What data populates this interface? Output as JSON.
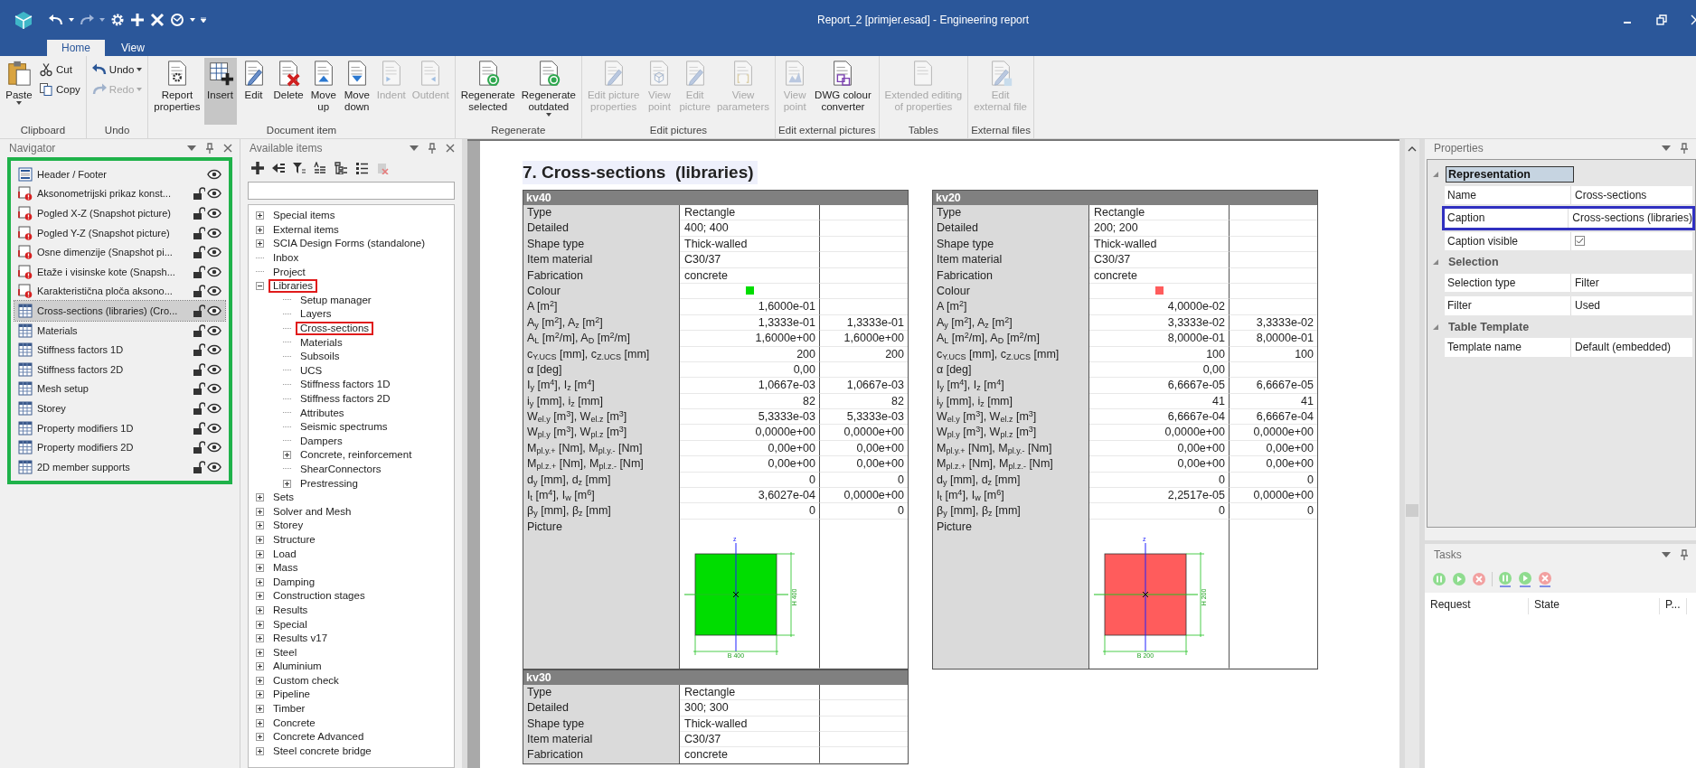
{
  "window": {
    "title": "Report_2 [primjer.esad] - Engineering report"
  },
  "ribbon": {
    "tabs": [
      {
        "label": "Home",
        "selected": true
      },
      {
        "label": "View",
        "selected": false
      }
    ],
    "groups": [
      {
        "label": "Clipboard",
        "buttons": [
          {
            "label": "Paste",
            "kind": "large",
            "dropdown": true,
            "disabled": false,
            "pressed": false
          },
          {
            "label": "Cut",
            "kind": "small",
            "dropdown": false,
            "disabled": false,
            "pressed": false
          },
          {
            "label": "Copy",
            "kind": "small",
            "dropdown": false,
            "disabled": false,
            "pressed": false
          }
        ]
      },
      {
        "label": "Undo",
        "buttons": [
          {
            "label": "Undo",
            "kind": "small",
            "dropdown": true,
            "disabled": false,
            "pressed": false
          },
          {
            "label": "Redo",
            "kind": "small",
            "dropdown": true,
            "disabled": true,
            "pressed": false
          }
        ]
      },
      {
        "label": "Document item",
        "buttons": [
          {
            "label": "Report\nproperties",
            "kind": "large",
            "dropdown": false,
            "disabled": false,
            "pressed": false
          },
          {
            "label": "Insert",
            "kind": "large",
            "dropdown": false,
            "disabled": false,
            "pressed": true
          },
          {
            "label": "Edit",
            "kind": "large",
            "dropdown": false,
            "disabled": false,
            "pressed": false
          },
          {
            "label": "Delete",
            "kind": "large",
            "dropdown": false,
            "disabled": false,
            "pressed": false
          },
          {
            "label": "Move\nup",
            "kind": "large",
            "dropdown": false,
            "disabled": false,
            "pressed": false
          },
          {
            "label": "Move\ndown",
            "kind": "large",
            "dropdown": false,
            "disabled": false,
            "pressed": false
          },
          {
            "label": "Indent",
            "kind": "large",
            "dropdown": false,
            "disabled": true,
            "pressed": false
          },
          {
            "label": "Outdent",
            "kind": "large",
            "dropdown": false,
            "disabled": true,
            "pressed": false
          }
        ]
      },
      {
        "label": "Regenerate",
        "buttons": [
          {
            "label": "Regenerate\nselected",
            "kind": "large",
            "dropdown": false,
            "disabled": false,
            "pressed": false
          },
          {
            "label": "Regenerate\noutdated",
            "kind": "large",
            "dropdown": true,
            "disabled": false,
            "pressed": false
          }
        ]
      },
      {
        "label": "Edit pictures",
        "buttons": [
          {
            "label": "Edit picture\nproperties",
            "kind": "large",
            "dropdown": false,
            "disabled": true,
            "pressed": false
          },
          {
            "label": "View\npoint",
            "kind": "large",
            "dropdown": false,
            "disabled": true,
            "pressed": false
          },
          {
            "label": "Edit\npicture",
            "kind": "large",
            "dropdown": false,
            "disabled": true,
            "pressed": false
          },
          {
            "label": "View\nparameters",
            "kind": "large",
            "dropdown": false,
            "disabled": true,
            "pressed": false
          }
        ]
      },
      {
        "label": "Edit external pictures",
        "buttons": [
          {
            "label": "View\npoint",
            "kind": "large",
            "dropdown": false,
            "disabled": true,
            "pressed": false
          },
          {
            "label": "DWG colour\nconverter",
            "kind": "large",
            "dropdown": false,
            "disabled": false,
            "pressed": false
          }
        ]
      },
      {
        "label": "Tables",
        "buttons": [
          {
            "label": "Extended editing\nof properties",
            "kind": "large",
            "dropdown": false,
            "disabled": true,
            "pressed": false
          }
        ]
      },
      {
        "label": "External files",
        "buttons": [
          {
            "label": "Edit\nexternal file",
            "kind": "large",
            "dropdown": false,
            "disabled": true,
            "pressed": false
          }
        ]
      }
    ]
  },
  "navigator": {
    "title": "Navigator",
    "highlighted": true,
    "items": [
      {
        "label": "Header / Footer",
        "kind": "header",
        "selected": false
      },
      {
        "label": "Aksonometrijski prikaz konst...",
        "kind": "picture",
        "selected": false
      },
      {
        "label": "Pogled X-Z (Snapshot picture)",
        "kind": "picture",
        "selected": false
      },
      {
        "label": "Pogled Y-Z (Snapshot picture)",
        "kind": "picture",
        "selected": false
      },
      {
        "label": "Osne dimenzije (Snapshot pi...",
        "kind": "picture",
        "selected": false
      },
      {
        "label": "Etaže i visinske kote (Snapsh...",
        "kind": "picture",
        "selected": false
      },
      {
        "label": "Karakteristična ploča aksono...",
        "kind": "picture",
        "selected": false
      },
      {
        "label": "Cross-sections (libraries) (Cro...",
        "kind": "table",
        "selected": true
      },
      {
        "label": "Materials",
        "kind": "table",
        "selected": false
      },
      {
        "label": "Stiffness factors 1D",
        "kind": "table",
        "selected": false
      },
      {
        "label": "Stiffness factors 2D",
        "kind": "table",
        "selected": false
      },
      {
        "label": "Mesh setup",
        "kind": "table",
        "selected": false
      },
      {
        "label": "Storey",
        "kind": "table",
        "selected": false
      },
      {
        "label": "Property modifiers 1D",
        "kind": "table",
        "selected": false
      },
      {
        "label": "Property modifiers 2D",
        "kind": "table",
        "selected": false
      },
      {
        "label": "2D member supports",
        "kind": "table",
        "selected": false
      }
    ]
  },
  "available_items": {
    "title": "Available items",
    "tree": [
      {
        "label": "Special items",
        "expanded": false,
        "highlighted": false
      },
      {
        "label": "External items",
        "expanded": false,
        "highlighted": false
      },
      {
        "label": "SCIA Design Forms (standalone)",
        "expanded": false,
        "highlighted": false
      },
      {
        "label": "Inbox",
        "highlighted": false
      },
      {
        "label": "Project",
        "highlighted": false
      },
      {
        "label": "Libraries",
        "expanded": true,
        "highlighted": true,
        "children": [
          {
            "label": "Setup manager",
            "highlighted": false
          },
          {
            "label": "Layers",
            "highlighted": false
          },
          {
            "label": "Cross-sections",
            "highlighted": true
          },
          {
            "label": "Materials",
            "highlighted": false
          },
          {
            "label": "Subsoils",
            "highlighted": false
          },
          {
            "label": "UCS",
            "highlighted": false
          },
          {
            "label": "Stiffness factors 1D",
            "highlighted": false
          },
          {
            "label": "Stiffness factors 2D",
            "highlighted": false
          },
          {
            "label": "Attributes",
            "highlighted": false
          },
          {
            "label": "Seismic spectrums",
            "highlighted": false
          },
          {
            "label": "Dampers",
            "highlighted": false
          },
          {
            "label": "Concrete, reinforcement",
            "expanded": false,
            "highlighted": false
          },
          {
            "label": "ShearConnectors",
            "highlighted": false
          },
          {
            "label": "Prestressing",
            "expanded": false,
            "highlighted": false
          }
        ]
      },
      {
        "label": "Sets",
        "expanded": false,
        "highlighted": false
      },
      {
        "label": "Solver and Mesh",
        "expanded": false,
        "highlighted": false
      },
      {
        "label": "Storey",
        "expanded": false,
        "highlighted": false
      },
      {
        "label": "Structure",
        "expanded": false,
        "highlighted": false
      },
      {
        "label": "Load",
        "expanded": false,
        "highlighted": false
      },
      {
        "label": "Mass",
        "expanded": false,
        "highlighted": false
      },
      {
        "label": "Damping",
        "expanded": false,
        "highlighted": false
      },
      {
        "label": "Construction stages",
        "expanded": false,
        "highlighted": false
      },
      {
        "label": "Results",
        "expanded": false,
        "highlighted": false
      },
      {
        "label": "Special",
        "expanded": false,
        "highlighted": false
      },
      {
        "label": "Results v17",
        "expanded": false,
        "highlighted": false
      },
      {
        "label": "Steel",
        "expanded": false,
        "highlighted": false
      },
      {
        "label": "Aluminium",
        "expanded": false,
        "highlighted": false
      },
      {
        "label": "Custom check",
        "expanded": false,
        "highlighted": false
      },
      {
        "label": "Pipeline",
        "expanded": false,
        "highlighted": false
      },
      {
        "label": "Timber",
        "expanded": false,
        "highlighted": false
      },
      {
        "label": "Concrete",
        "expanded": false,
        "highlighted": false
      },
      {
        "label": "Concrete Advanced",
        "expanded": false,
        "highlighted": false
      },
      {
        "label": "Steel concrete bridge",
        "expanded": false,
        "highlighted": false
      }
    ]
  },
  "document": {
    "heading": "7. Cross-sections  (libraries)",
    "sections": [
      {
        "name": "kv40",
        "color": "#00dd00",
        "rows": [
          {
            "label": "Type",
            "kind": "text",
            "value": "Rectangle"
          },
          {
            "label": "Detailed",
            "kind": "text",
            "value": "400; 400"
          },
          {
            "label": "Shape type",
            "kind": "text",
            "value": "Thick-walled"
          },
          {
            "label": "Item material",
            "kind": "text",
            "value": "C30/37"
          },
          {
            "label": "Fabrication",
            "kind": "text",
            "value": "concrete"
          },
          {
            "label": "Colour",
            "kind": "colour"
          },
          {
            "label": "A [m$^{2}$]",
            "kind": "number",
            "value": "1,6000e-01"
          },
          {
            "label": "A$_{y}$ [m$^{2}$], A$_{z}$ [m$^{2}$]",
            "kind": "number",
            "value": "1,3333e-01",
            "value_2": "1,3333e-01"
          },
          {
            "label": "A$_{L}$ [m$^{2}$/m], A$_{D}$ [m$^{2}$/m]",
            "kind": "number",
            "value": "1,6000e+00",
            "value_2": "1,6000e+00"
          },
          {
            "label": "c$_{Y.UCS}$ [mm], c$_{Z.UCS}$ [mm]",
            "kind": "number",
            "value": "200",
            "value_2": "200"
          },
          {
            "label": "α [deg]",
            "kind": "number",
            "value": "0,00"
          },
          {
            "label": "I$_{y}$ [m$^{4}$], I$_{z}$ [m$^{4}$]",
            "kind": "number",
            "value": "1,0667e-03",
            "value_2": "1,0667e-03"
          },
          {
            "label": "i$_{y}$ [mm], i$_{z}$ [mm]",
            "kind": "number",
            "value": "82",
            "value_2": "82"
          },
          {
            "label": "W$_{el.y}$ [m$^{3}$], W$_{el.z}$ [m$^{3}$]",
            "kind": "number",
            "value": "5,3333e-03",
            "value_2": "5,3333e-03"
          },
          {
            "label": "W$_{pl.y}$ [m$^{3}$], W$_{pl.z}$ [m$^{3}$]",
            "kind": "number",
            "value": "0,0000e+00",
            "value_2": "0,0000e+00"
          },
          {
            "label": "M$_{pl.y.+}$ [Nm], M$_{pl.y.-}$ [Nm]",
            "kind": "number",
            "value": "0,00e+00",
            "value_2": "0,00e+00"
          },
          {
            "label": "M$_{pl.z.+}$ [Nm], M$_{pl.z.-}$ [Nm]",
            "kind": "number",
            "value": "0,00e+00",
            "value_2": "0,00e+00"
          },
          {
            "label": "d$_{y}$ [mm], d$_{z}$ [mm]",
            "kind": "number",
            "value": "0",
            "value_2": "0"
          },
          {
            "label": "I$_{t}$ [m$^{4}$], I$_{w}$ [m$^{6}$]",
            "kind": "number",
            "value": "3,6027e-04",
            "value_2": "0,0000e+00"
          },
          {
            "label": "β$_{y}$ [mm], β$_{z}$ [mm]",
            "kind": "number",
            "value": "0",
            "value_2": "0"
          },
          {
            "label": "Picture",
            "kind": "picture",
            "axis_label": "z",
            "height_label": "H 400",
            "width_label": "B 400"
          }
        ]
      },
      {
        "name": "kv20",
        "color": "#ff5c5c",
        "rows": [
          {
            "label": "Type",
            "kind": "text",
            "value": "Rectangle"
          },
          {
            "label": "Detailed",
            "kind": "text",
            "value": "200; 200"
          },
          {
            "label": "Shape type",
            "kind": "text",
            "value": "Thick-walled"
          },
          {
            "label": "Item material",
            "kind": "text",
            "value": "C30/37"
          },
          {
            "label": "Fabrication",
            "kind": "text",
            "value": "concrete"
          },
          {
            "label": "Colour",
            "kind": "colour"
          },
          {
            "label": "A [m$^{2}$]",
            "kind": "number",
            "value": "4,0000e-02"
          },
          {
            "label": "A$_{y}$ [m$^{2}$], A$_{z}$ [m$^{2}$]",
            "kind": "number",
            "value": "3,3333e-02",
            "value_2": "3,3333e-02"
          },
          {
            "label": "A$_{L}$ [m$^{2}$/m], A$_{D}$ [m$^{2}$/m]",
            "kind": "number",
            "value": "8,0000e-01",
            "value_2": "8,0000e-01"
          },
          {
            "label": "c$_{Y.UCS}$ [mm], c$_{Z.UCS}$ [mm]",
            "kind": "number",
            "value": "100",
            "value_2": "100"
          },
          {
            "label": "α [deg]",
            "kind": "number",
            "value": "0,00"
          },
          {
            "label": "I$_{y}$ [m$^{4}$], I$_{z}$ [m$^{4}$]",
            "kind": "number",
            "value": "6,6667e-05",
            "value_2": "6,6667e-05"
          },
          {
            "label": "i$_{y}$ [mm], i$_{z}$ [mm]",
            "kind": "number",
            "value": "41",
            "value_2": "41"
          },
          {
            "label": "W$_{el.y}$ [m$^{3}$], W$_{el.z}$ [m$^{3}$]",
            "kind": "number",
            "value": "6,6667e-04",
            "value_2": "6,6667e-04"
          },
          {
            "label": "W$_{pl.y}$ [m$^{3}$], W$_{pl.z}$ [m$^{3}$]",
            "kind": "number",
            "value": "0,0000e+00",
            "value_2": "0,0000e+00"
          },
          {
            "label": "M$_{pl.y.+}$ [Nm], M$_{pl.y.-}$ [Nm]",
            "kind": "number",
            "value": "0,00e+00",
            "value_2": "0,00e+00"
          },
          {
            "label": "M$_{pl.z.+}$ [Nm], M$_{pl.z.-}$ [Nm]",
            "kind": "number",
            "value": "0,00e+00",
            "value_2": "0,00e+00"
          },
          {
            "label": "d$_{y}$ [mm], d$_{z}$ [mm]",
            "kind": "number",
            "value": "0",
            "value_2": "0"
          },
          {
            "label": "I$_{t}$ [m$^{4}$], I$_{w}$ [m$^{6}$]",
            "kind": "number",
            "value": "2,2517e-05",
            "value_2": "0,0000e+00"
          },
          {
            "label": "β$_{y}$ [mm], β$_{z}$ [mm]",
            "kind": "number",
            "value": "0",
            "value_2": "0"
          },
          {
            "label": "Picture",
            "kind": "picture",
            "axis_label": "z",
            "height_label": "H 200",
            "width_label": "B 200"
          }
        ]
      },
      {
        "name": "kv30",
        "rows": [
          {
            "label": "Type",
            "kind": "text",
            "value": "Rectangle"
          },
          {
            "label": "Detailed",
            "kind": "text",
            "value": "300; 300"
          },
          {
            "label": "Shape type",
            "kind": "text",
            "value": "Thick-walled"
          },
          {
            "label": "Item material",
            "kind": "text",
            "value": "C30/37"
          },
          {
            "label": "Fabrication",
            "kind": "text",
            "value": "concrete"
          }
        ]
      }
    ]
  },
  "properties": {
    "title": "Properties",
    "groups": [
      {
        "label": "Representation",
        "selected": true,
        "rows": [
          {
            "label": "Name",
            "kind": "text",
            "value": "Cross-sections",
            "highlighted": false
          },
          {
            "label": "Caption",
            "kind": "text",
            "value": "Cross-sections (libraries)",
            "highlighted": true
          },
          {
            "label": "Caption visible",
            "kind": "checkbox",
            "checked": true,
            "highlighted": false
          }
        ]
      },
      {
        "label": "Selection",
        "selected": false,
        "rows": [
          {
            "label": "Selection type",
            "kind": "text",
            "value": "Filter",
            "highlighted": false
          },
          {
            "label": "Filter",
            "kind": "text",
            "value": "Used",
            "highlighted": false
          }
        ]
      },
      {
        "label": "Table Template",
        "selected": false,
        "rows": [
          {
            "label": "Template name",
            "kind": "text",
            "value": "Default (embedded)",
            "highlighted": false
          }
        ]
      }
    ]
  },
  "tasks": {
    "title": "Tasks",
    "columns": [
      "Request",
      "State",
      "P..."
    ]
  }
}
